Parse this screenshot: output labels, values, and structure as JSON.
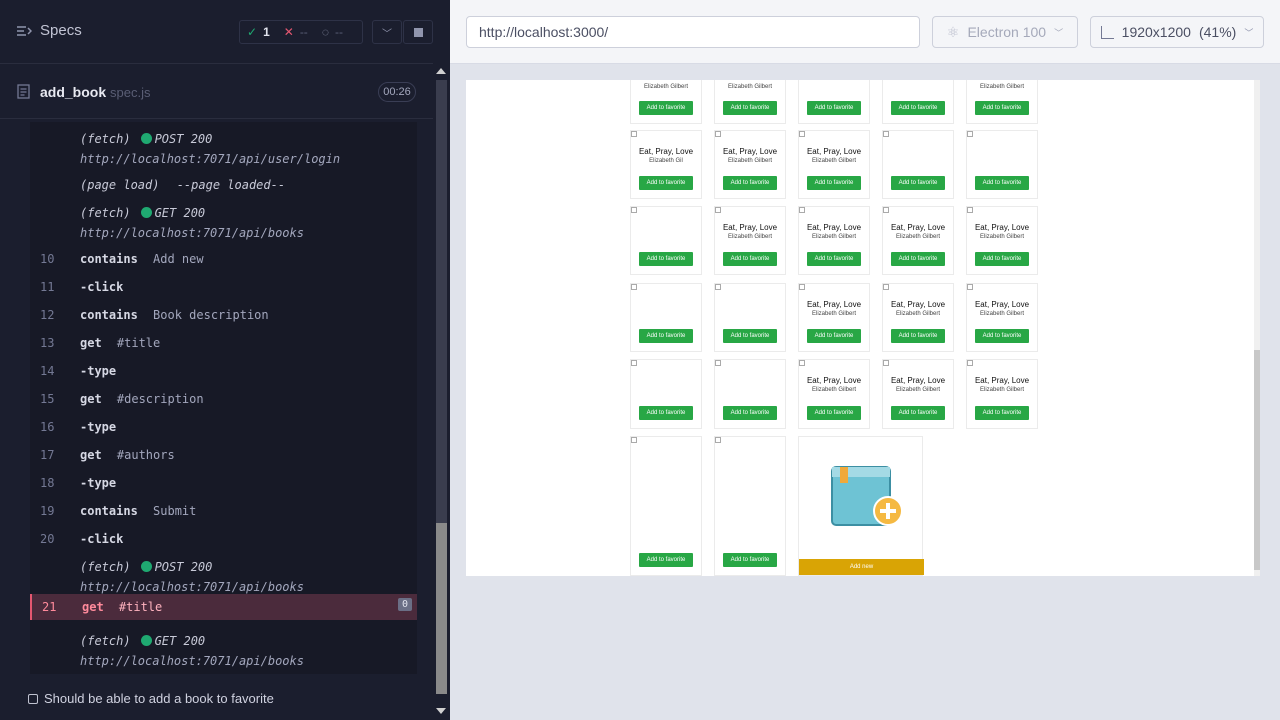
{
  "reporter": {
    "specs_label": "Specs",
    "stats": {
      "passed": "1",
      "failed": "--",
      "pending": "--"
    },
    "spec": {
      "name": "add_book",
      "file": "spec.js",
      "duration": "00:26"
    },
    "commands": [
      {
        "kind": "meta",
        "text": "(fetch)",
        "status": "POST 200",
        "url": "http://localhost:7071/api/user/login"
      },
      {
        "kind": "meta-simple",
        "text": "(page load)",
        "detail": "--page loaded--"
      },
      {
        "kind": "meta",
        "text": "(fetch)",
        "status": "GET 200",
        "url": "http://localhost:7071/api/books"
      },
      {
        "num": "10",
        "name": "contains",
        "msg": "Add new"
      },
      {
        "num": "11",
        "name": "-click",
        "msg": ""
      },
      {
        "num": "12",
        "name": "contains",
        "msg": "Book description"
      },
      {
        "num": "13",
        "name": "get",
        "msg": "#title"
      },
      {
        "num": "14",
        "name": "-type",
        "msg": ""
      },
      {
        "num": "15",
        "name": "get",
        "msg": "#description"
      },
      {
        "num": "16",
        "name": "-type",
        "msg": ""
      },
      {
        "num": "17",
        "name": "get",
        "msg": "#authors"
      },
      {
        "num": "18",
        "name": "-type",
        "msg": ""
      },
      {
        "num": "19",
        "name": "contains",
        "msg": "Submit"
      },
      {
        "num": "20",
        "name": "-click",
        "msg": ""
      },
      {
        "kind": "meta",
        "text": "(fetch)",
        "status": "POST 200",
        "url": "http://localhost:7071/api/books"
      },
      {
        "num": "21",
        "name": "get",
        "msg": "#title",
        "active": true,
        "badge": "0"
      },
      {
        "kind": "meta",
        "text": "(fetch)",
        "status": "GET 200",
        "url": "http://localhost:7071/api/books"
      }
    ],
    "test_title": "Should be able to add a book to favorite"
  },
  "aut": {
    "url": "http://localhost:3000/",
    "browser": "Electron 100",
    "viewport": "1920x1200",
    "scale": "(41%)",
    "book_title": "Eat, Pray, Love",
    "book_author": "Elizabeth Gilbert",
    "book_author_short": "Elizabeth Gil",
    "fav_label": "Add to favorite",
    "add_new_label": "Add new"
  }
}
